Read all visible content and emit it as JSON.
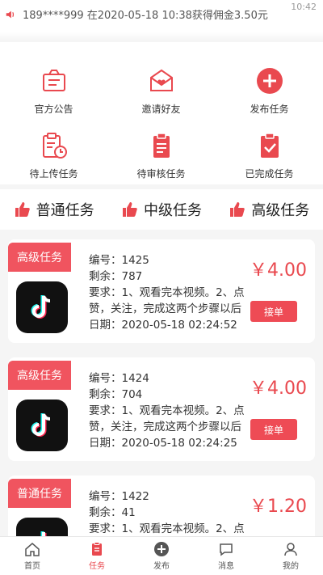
{
  "status_bar": {
    "time": "10:42"
  },
  "notice": {
    "text": "189****999 在2020-05-18 10:38获得佣金3.50元"
  },
  "menu": [
    {
      "label": "官方公告",
      "icon": "announcement-icon"
    },
    {
      "label": "邀请好友",
      "icon": "invite-envelope-icon"
    },
    {
      "label": "发布任务",
      "icon": "plus-circle-icon"
    },
    {
      "label": "待上传任务",
      "icon": "clipboard-clock-icon"
    },
    {
      "label": "待审核任务",
      "icon": "clipboard-list-icon"
    },
    {
      "label": "已完成任务",
      "icon": "clipboard-check-icon"
    }
  ],
  "tabs": [
    {
      "label": "普通任务"
    },
    {
      "label": "中级任务"
    },
    {
      "label": "高级任务"
    }
  ],
  "tasks": [
    {
      "badge": "高级任务",
      "id": "编号：1425",
      "remaining": "剩余：787",
      "require": "要求：1、观看完本视频。2、点",
      "require2": "赞，关注，完成这两个步骤以后",
      "date": "日期：2020-05-18 02:24:52",
      "price": "￥4.00",
      "button": "接单"
    },
    {
      "badge": "高级任务",
      "id": "编号：1424",
      "remaining": "剩余：704",
      "require": "要求：1、观看完本视频。2、点",
      "require2": "赞，关注，完成这两个步骤以后",
      "date": "日期：2020-05-18 02:24:25",
      "price": "￥4.00",
      "button": "接单"
    },
    {
      "badge": "普通任务",
      "id": "编号：1422",
      "remaining": "剩余：41",
      "require": "要求：1、观看完本视频。2、点",
      "require2": "",
      "date": "",
      "price": "￥1.20",
      "button": ""
    }
  ],
  "nav": [
    {
      "label": "首页",
      "icon": "home-icon"
    },
    {
      "label": "任务",
      "icon": "task-icon"
    },
    {
      "label": "发布",
      "icon": "publish-icon"
    },
    {
      "label": "消息",
      "icon": "message-icon"
    },
    {
      "label": "我的",
      "icon": "profile-icon"
    }
  ],
  "colors": {
    "accent": "#e9494f",
    "badge": "#f0545f"
  }
}
